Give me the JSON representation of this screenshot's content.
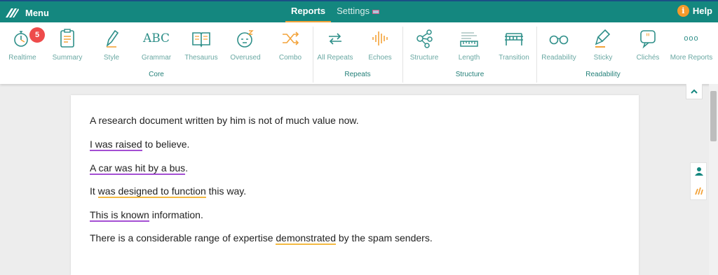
{
  "header": {
    "menu_label": "Menu",
    "tabs": [
      {
        "label": "Reports",
        "active": true
      },
      {
        "label": "Settings",
        "active": false
      }
    ],
    "help_label": "Help",
    "help_icon_glyph": "i",
    "accent": "#14877f"
  },
  "toolbar": {
    "tools": [
      {
        "label": "Realtime",
        "icon": "stopwatch-icon",
        "badge": "5"
      },
      {
        "label": "Summary",
        "icon": "clipboard-icon"
      },
      {
        "label": "Style",
        "icon": "pen-icon"
      },
      {
        "label": "Grammar",
        "icon": "abc-check-icon",
        "glyph": "ABC"
      },
      {
        "label": "Thesaurus",
        "icon": "book-icon"
      },
      {
        "label": "Overused",
        "icon": "sleepy-face-icon"
      },
      {
        "label": "Combo",
        "icon": "shuffle-icon"
      },
      {
        "label": "All Repeats",
        "icon": "repeat-arrows-icon"
      },
      {
        "label": "Echoes",
        "icon": "sound-wave-icon"
      },
      {
        "label": "Structure",
        "icon": "network-icon"
      },
      {
        "label": "Length",
        "icon": "ruler-icon"
      },
      {
        "label": "Transition",
        "icon": "bridge-icon"
      },
      {
        "label": "Readability",
        "icon": "glasses-icon"
      },
      {
        "label": "Sticky",
        "icon": "glue-icon"
      },
      {
        "label": "Clichés",
        "icon": "quote-bubble-icon"
      },
      {
        "label": "More Reports",
        "icon": "more-dots-icon",
        "glyph": "ooo"
      }
    ],
    "groups": [
      "Core",
      "Repeats",
      "Structure",
      "Readability"
    ]
  },
  "document": {
    "sentences": [
      {
        "parts": [
          {
            "text": "A research document written by him is not of much value now."
          }
        ]
      },
      {
        "parts": [
          {
            "text": "I was raised",
            "mark": "purple"
          },
          {
            "text": " to believe."
          }
        ]
      },
      {
        "parts": [
          {
            "text": "A car was hit by a bus",
            "mark": "purple"
          },
          {
            "text": "."
          }
        ]
      },
      {
        "parts": [
          {
            "text": "It "
          },
          {
            "text": "was designed to function",
            "mark": "orange"
          },
          {
            "text": " this way."
          }
        ]
      },
      {
        "parts": [
          {
            "text": "This is known",
            "mark": "purple"
          },
          {
            "text": " information."
          }
        ]
      },
      {
        "parts": [
          {
            "text": "There is a considerable range of expertise "
          },
          {
            "text": "demonstrated",
            "mark": "orange"
          },
          {
            "text": " by the spam senders."
          }
        ]
      }
    ]
  },
  "colors": {
    "teal": "#14877f",
    "icon_teal": "#2e8f89",
    "badge_red": "#ee4b4b",
    "passive_purple": "#a44fd3",
    "hidden_verb_orange": "#f3b941"
  }
}
